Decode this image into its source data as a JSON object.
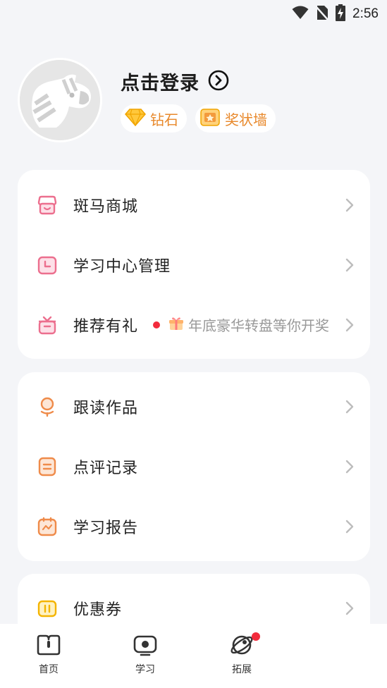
{
  "status_bar": {
    "time": "2:56"
  },
  "profile": {
    "login_label": "点击登录",
    "badges": [
      {
        "label": "钻石",
        "icon": "diamond-icon"
      },
      {
        "label": "奖状墙",
        "icon": "certificate-icon"
      }
    ]
  },
  "menu_groups": [
    {
      "items": [
        {
          "label": "斑马商城",
          "icon": "shop-icon"
        },
        {
          "label": "学习中心管理",
          "icon": "clock-calendar-icon"
        },
        {
          "label": "推荐有礼",
          "icon": "gift-box-icon",
          "promo": "年底豪华转盘等你开奖",
          "promo_icon": "gift-emoji-icon"
        }
      ]
    },
    {
      "items": [
        {
          "label": "跟读作品",
          "icon": "microphone-icon"
        },
        {
          "label": "点评记录",
          "icon": "comment-record-icon"
        },
        {
          "label": "学习报告",
          "icon": "report-chart-icon"
        }
      ]
    },
    {
      "items": [
        {
          "label": "优惠券",
          "icon": "coupon-icon"
        }
      ]
    }
  ],
  "tabbar": {
    "tabs": [
      {
        "label": "首页",
        "icon": "book-home-icon"
      },
      {
        "label": "学习",
        "icon": "tv-play-icon"
      },
      {
        "label": "拓展",
        "icon": "planet-icon",
        "has_notification": true
      }
    ]
  },
  "colors": {
    "accent_pink": "#ec6f8e",
    "accent_orange": "#ef8b4a",
    "accent_yellow": "#f4b400",
    "badge_text": "#e8882a",
    "notification": "#f22b3c"
  }
}
